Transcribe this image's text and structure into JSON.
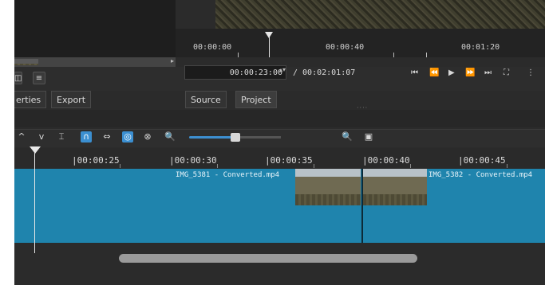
{
  "player": {
    "ruler_labels": [
      "00:00:00",
      "00:00:40",
      "00:01:20"
    ],
    "current_time": "00:00:23:00",
    "duration": "/ 00:02:01:07"
  },
  "tabs": {
    "properties": "erties",
    "export": "Export",
    "source": "Source",
    "project": "Project"
  },
  "icons": {
    "grid_icon": "◫",
    "menu_icon": "≡",
    "timecode_spin": "▴▾",
    "transport": [
      "⏮",
      "⏪",
      "▶",
      "⏩",
      "⏭",
      "⛶",
      "⋮"
    ]
  },
  "timeline_toolbar": {
    "icons": [
      "^",
      "v",
      "⌶",
      "∩",
      "⇔",
      "◎",
      "⊗"
    ],
    "zoom_out": "🔍",
    "zoom_in": "🔍",
    "fit": "▣",
    "zoom_level": 0.45
  },
  "timeline_ruler": {
    "labels": [
      "|00:00:25",
      "|00:00:30",
      "|00:00:35",
      "|00:00:40",
      "|00:00:45"
    ]
  },
  "clips": [
    {
      "title": "IMG_5381 - Converted.mp4"
    },
    {
      "title": "IMG_5382 - Converted.mp4"
    }
  ],
  "colors": {
    "track": "#2285ad",
    "accent": "#3b8fd1"
  }
}
